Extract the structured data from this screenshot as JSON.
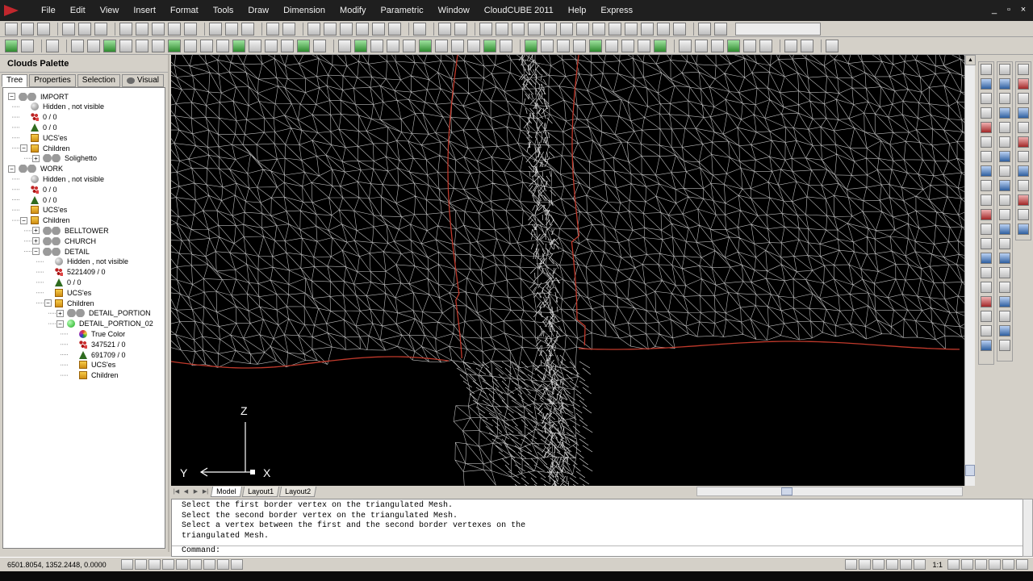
{
  "menu": {
    "items": [
      "File",
      "Edit",
      "View",
      "Insert",
      "Format",
      "Tools",
      "Draw",
      "Dimension",
      "Modify",
      "Parametric",
      "Window",
      "CloudCUBE 2011",
      "Help",
      "Express"
    ],
    "window_controls": [
      "_",
      "▫",
      "×"
    ]
  },
  "palette": {
    "title": "Clouds Palette",
    "tabs": [
      "Tree",
      "Properties",
      "Selection",
      "Visual"
    ],
    "tree": [
      {
        "label": "IMPORT",
        "icon": "eyes-icon",
        "depth": 0,
        "expander": "−"
      },
      {
        "label": "Hidden , not visible",
        "icon": "bulb-icon",
        "depth": 1
      },
      {
        "label": "0 / 0",
        "icon": "points-icon",
        "depth": 1
      },
      {
        "label": "0 / 0",
        "icon": "triangle-icon",
        "depth": 1
      },
      {
        "label": "UCS'es",
        "icon": "folder-icon",
        "depth": 1
      },
      {
        "label": "Children",
        "icon": "folder-icon",
        "depth": 1,
        "expander": "−"
      },
      {
        "label": "Solighetto",
        "icon": "eyes-icon",
        "depth": 2,
        "expander": "+"
      },
      {
        "label": "WORK",
        "icon": "eyes-icon",
        "depth": 0,
        "expander": "−"
      },
      {
        "label": "Hidden , not visible",
        "icon": "bulb-icon",
        "depth": 1
      },
      {
        "label": "0 / 0",
        "icon": "points-icon",
        "depth": 1
      },
      {
        "label": "0 / 0",
        "icon": "triangle-icon",
        "depth": 1
      },
      {
        "label": "UCS'es",
        "icon": "folder-icon",
        "depth": 1
      },
      {
        "label": "Children",
        "icon": "folder-icon",
        "depth": 1,
        "expander": "−"
      },
      {
        "label": "BELLTOWER",
        "icon": "eyes-icon",
        "depth": 2,
        "expander": "+"
      },
      {
        "label": "CHURCH",
        "icon": "eyes-icon",
        "depth": 2,
        "expander": "+"
      },
      {
        "label": "DETAIL",
        "icon": "eyes-icon",
        "depth": 2,
        "expander": "−"
      },
      {
        "label": "Hidden , not visible",
        "icon": "bulb-icon",
        "depth": 3
      },
      {
        "label": "5221409 / 0",
        "icon": "points-icon",
        "depth": 3
      },
      {
        "label": "0 / 0",
        "icon": "triangle-icon",
        "depth": 3
      },
      {
        "label": "UCS'es",
        "icon": "folder-icon",
        "depth": 3
      },
      {
        "label": "Children",
        "icon": "folder-icon",
        "depth": 3,
        "expander": "−"
      },
      {
        "label": "DETAIL_PORTION",
        "icon": "eyes-icon",
        "depth": 4,
        "expander": "+"
      },
      {
        "label": "DETAIL_PORTION_02",
        "icon": "bulb-green-icon",
        "depth": 4,
        "expander": "−"
      },
      {
        "label": "True Color",
        "icon": "color-wheel-icon",
        "depth": 5
      },
      {
        "label": "347521 / 0",
        "icon": "points-icon",
        "depth": 5
      },
      {
        "label": "691709 / 0",
        "icon": "triangle-icon",
        "depth": 5
      },
      {
        "label": "UCS'es",
        "icon": "folder-icon",
        "depth": 5
      },
      {
        "label": "Children",
        "icon": "folder-icon",
        "depth": 5
      }
    ]
  },
  "viewport": {
    "background": "#000000",
    "mesh_color": "#d9d9d9",
    "border_color": "#c0392b",
    "ucs": {
      "z": "Z",
      "y": "Y",
      "x": "X"
    }
  },
  "layout_tabs": [
    "Model",
    "Layout1",
    "Layout2"
  ],
  "command": {
    "history": [
      "Select the first border vertex on the triangulated Mesh.",
      "Select the second border vertex on the triangulated Mesh.",
      "Select a vertex between the first and the second border vertexes on the",
      "triangulated Mesh."
    ],
    "prompt": "Command:"
  },
  "status": {
    "coordinates": "6501.8054, 1352.2448, 0.0000",
    "annotation_scale": "1:1"
  }
}
